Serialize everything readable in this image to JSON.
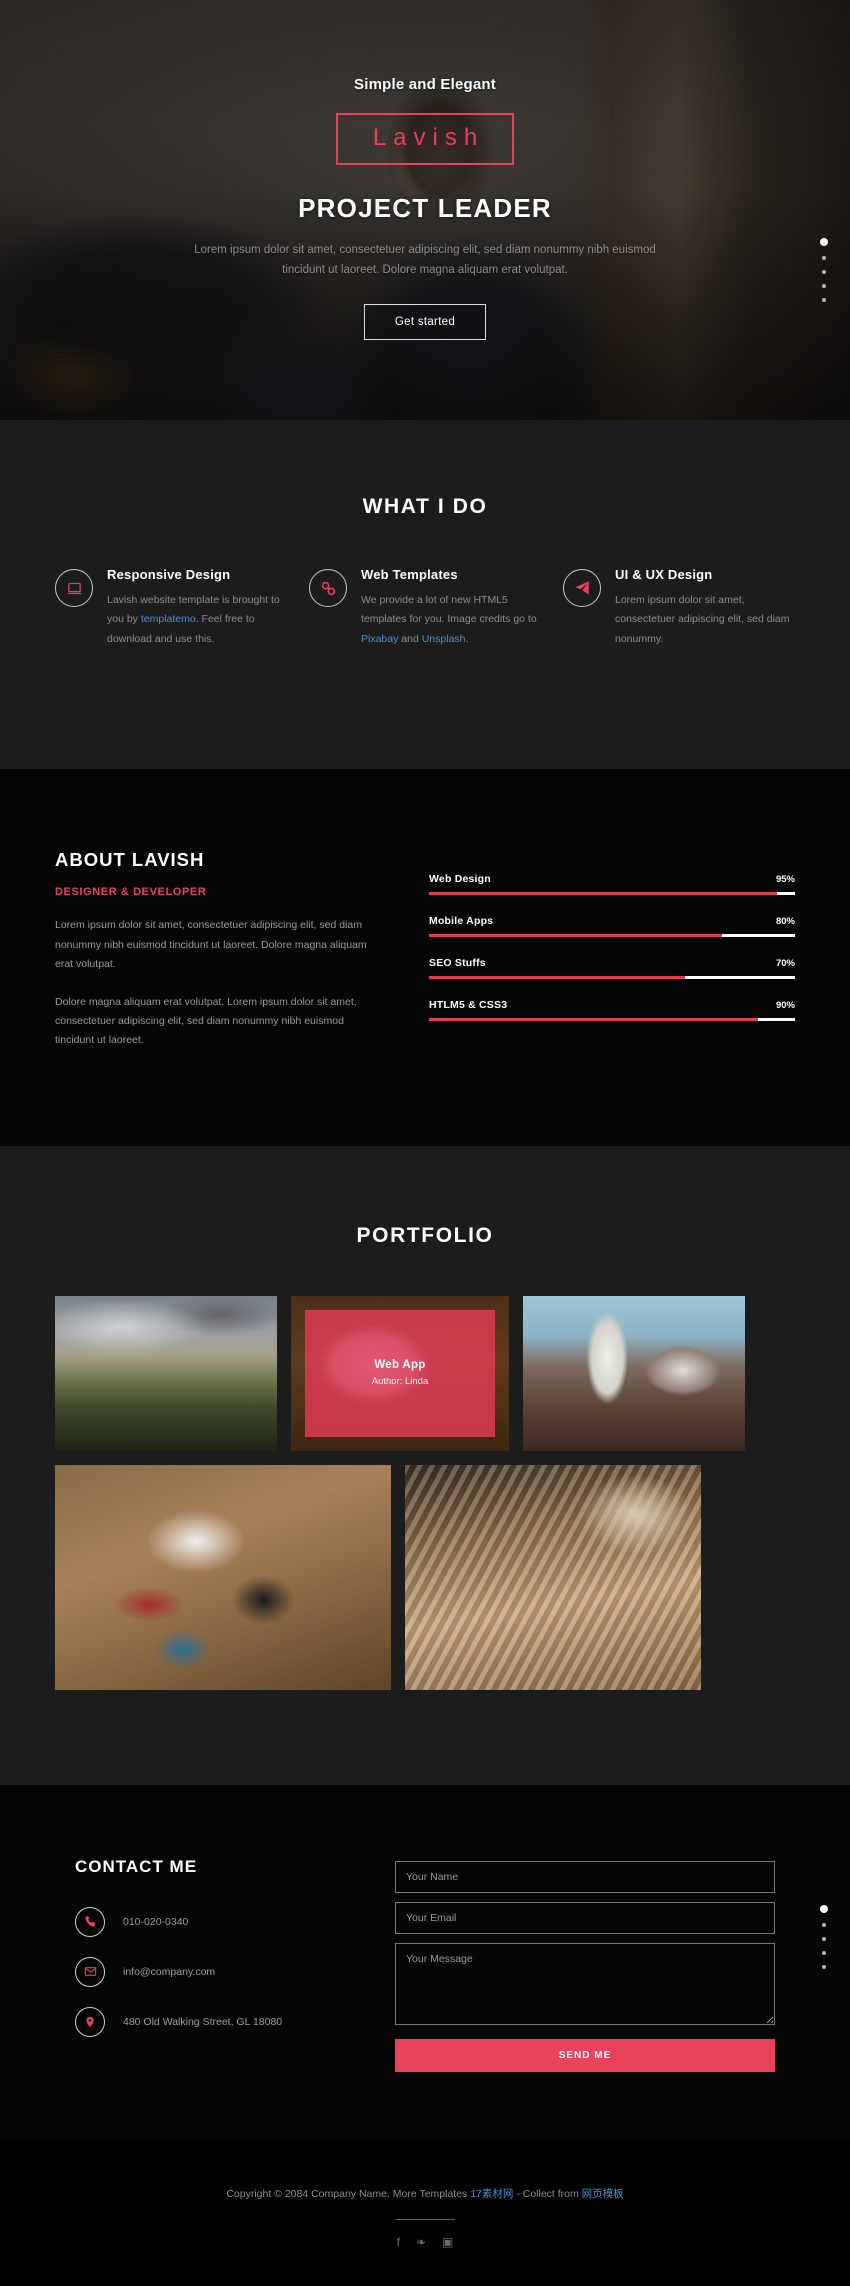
{
  "hero": {
    "subtitle": "Simple and Elegant",
    "logo": "Lavish",
    "title": "PROJECT LEADER",
    "description": "Lorem ipsum dolor sit amet, consectetuer adipiscing elit, sed diam nonummy nibh euismod tincidunt ut laoreet. Dolore magna aliquam erat volutpat.",
    "button": "Get started",
    "accent_color": "#e8415c"
  },
  "nav_dots": {
    "count": 5,
    "active_index": 0
  },
  "what_i_do": {
    "title": "WHAT I DO",
    "services": [
      {
        "icon": "laptop-icon",
        "title": "Responsive Design",
        "text_before": "Lavish website template is brought to you by ",
        "link1": "templatemo",
        "text_mid": ". Feel free to download and use this.",
        "link2": "",
        "text_after": ""
      },
      {
        "icon": "link-chain-icon",
        "title": "Web Templates",
        "text_before": "We provide a lot of new HTML5 templates for you. Image credits go to ",
        "link1": "Pixabay",
        "text_mid": " and ",
        "link2": "Unsplash",
        "text_after": "."
      },
      {
        "icon": "paper-plane-icon",
        "title": "UI & UX Design",
        "text_before": "Lorem ipsum dolor sit amet, consectetuer adipiscing elit, sed diam nonummy.",
        "link1": "",
        "text_mid": "",
        "link2": "",
        "text_after": ""
      }
    ]
  },
  "about": {
    "heading": "ABOUT LAVISH",
    "role": "DESIGNER & DEVELOPER",
    "paragraph1": "Lorem ipsum dolor sit amet, consectetuer adipiscing elit, sed diam nonummy nibh euismod tincidunt ut laoreet. Dolore magna aliquam erat volutpat.",
    "paragraph2": "Dolore magna aliquam erat volutpat. Lorem ipsum dolor sit amet, consectetuer adipiscing elit, sed diam nonummy nibh euismod tincidunt ut laoreet.",
    "bar_color": "#e03b52",
    "track_color": "#ffffff",
    "skills": [
      {
        "name": "Web Design",
        "percent": 95,
        "label": "95%"
      },
      {
        "name": "Mobile Apps",
        "percent": 80,
        "label": "80%"
      },
      {
        "name": "SEO Stuffs",
        "percent": 70,
        "label": "70%"
      },
      {
        "name": "HTLM5 & CSS3",
        "percent": 90,
        "label": "90%"
      }
    ]
  },
  "portfolio": {
    "title": "PORTFOLIO",
    "overlay_color": "#e33c58",
    "items": [
      {
        "photo": "ph-mountain",
        "overlay": false,
        "title": "",
        "author": ""
      },
      {
        "photo": "ph-laptop",
        "overlay": true,
        "title": "Web App",
        "author": "Author: Linda"
      },
      {
        "photo": "ph-coffee",
        "overlay": false,
        "title": "",
        "author": ""
      },
      {
        "photo": "ph-desk",
        "overlay": false,
        "title": "",
        "author": ""
      },
      {
        "photo": "ph-pencils",
        "overlay": false,
        "title": "",
        "author": ""
      }
    ]
  },
  "contact": {
    "heading": "CONTACT ME",
    "details": [
      {
        "icon": "phone-icon",
        "value": "010-020-0340"
      },
      {
        "icon": "envelope-icon",
        "value": "info@company.com"
      },
      {
        "icon": "map-pin-icon",
        "value": "480 Old Walking Street, GL 18080"
      }
    ],
    "form": {
      "name_placeholder": "Your Name",
      "name_value": "",
      "email_placeholder": "Your Email",
      "email_value": "",
      "message_placeholder": "Your Message",
      "message_value": "",
      "submit_label": "SEND ME",
      "submit_color": "#e8415c"
    }
  },
  "footer": {
    "copyright_before": "Copyright © 2084 Company Name. More Templates ",
    "link1": "17素材网",
    "copyright_mid": " - Collect from ",
    "link2": "网页模板",
    "socials": [
      {
        "icon": "facebook-icon",
        "glyph": "f"
      },
      {
        "icon": "twitter-icon",
        "glyph": "❧"
      },
      {
        "icon": "instagram-icon",
        "glyph": "▣"
      }
    ]
  }
}
